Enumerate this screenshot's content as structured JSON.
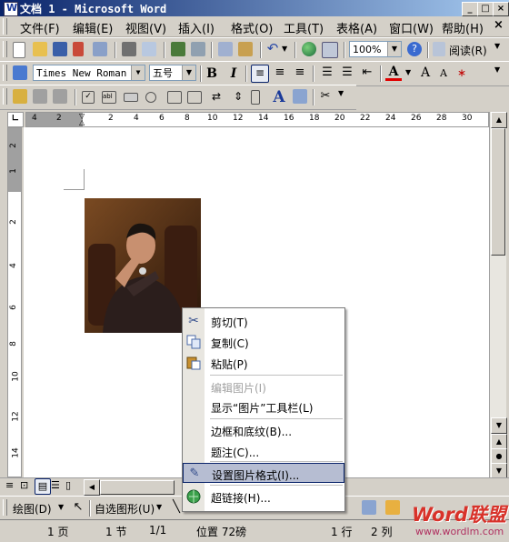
{
  "window": {
    "title": "文档 1 - Microsoft Word",
    "buttons": [
      "_",
      "□",
      "×"
    ]
  },
  "menubar": {
    "items": [
      "文件(F)",
      "编辑(E)",
      "视图(V)",
      "插入(I)",
      "格式(O)",
      "工具(T)",
      "表格(A)",
      "窗口(W)",
      "帮助(H)"
    ],
    "close": "×"
  },
  "standard_toolbar": {
    "zoom": "100%",
    "read_label": "阅读(R)"
  },
  "format_toolbar": {
    "font": "Times New Roman",
    "size": "五号",
    "bold": "B",
    "italic": "I",
    "font_a": "A"
  },
  "forms_toolbar": {
    "a_glyph": "A"
  },
  "ruler": {
    "h_numbers": [
      "4",
      "2",
      "2",
      "4",
      "6",
      "8",
      "10",
      "12",
      "14",
      "16",
      "18",
      "20",
      "22",
      "24",
      "26",
      "28",
      "30"
    ],
    "v_numbers": [
      "2",
      "1",
      "2",
      "4",
      "6",
      "8",
      "10",
      "12",
      "14"
    ]
  },
  "context_menu": {
    "items": [
      {
        "label": "剪切(T)",
        "icon": "scissors-icon",
        "enabled": true
      },
      {
        "label": "复制(C)",
        "icon": "copy-icon",
        "enabled": true
      },
      {
        "label": "粘贴(P)",
        "icon": "paste-icon",
        "enabled": true
      },
      {
        "label": "编辑图片(I)",
        "icon": "",
        "enabled": false
      },
      {
        "label": "显示“图片”工具栏(L)",
        "icon": "",
        "enabled": true
      },
      {
        "label": "边框和底纹(B)...",
        "icon": "",
        "enabled": true
      },
      {
        "label": "题注(C)...",
        "icon": "",
        "enabled": true
      },
      {
        "label": "设置图片格式(I)...",
        "icon": "format-picture-icon",
        "enabled": true,
        "highlighted": true
      },
      {
        "label": "超链接(H)...",
        "icon": "hyperlink-icon",
        "enabled": true
      }
    ]
  },
  "drawing_toolbar": {
    "draw": "绘图(D)",
    "autoshapes": "自选图形(U)"
  },
  "statusbar": {
    "page": "1 页",
    "section": "1 节",
    "pages": "1/1",
    "position": "位置 72磅",
    "line": "1 行",
    "column": "2 列"
  },
  "watermark": {
    "brand": "Word联盟",
    "url": "www.wordlm.com"
  },
  "colors": {
    "title_start": "#0a246a",
    "title_end": "#a6caf0",
    "menu_highlight": "#b6bdd2",
    "chrome": "#d4d0c8"
  }
}
